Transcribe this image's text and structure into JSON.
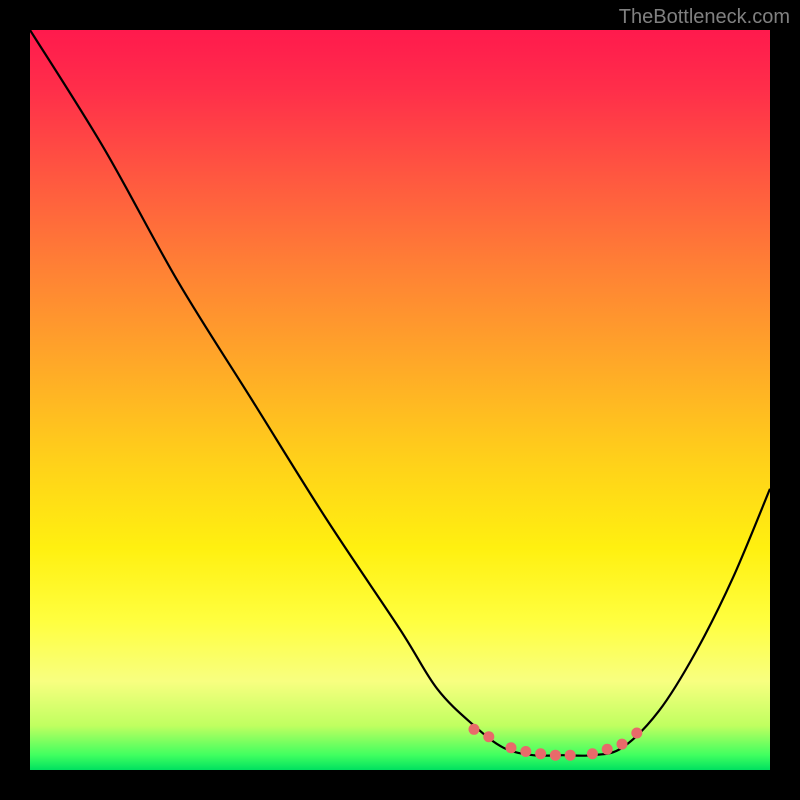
{
  "watermark": "TheBottleneck.com",
  "chart_data": {
    "type": "line",
    "title": "",
    "xlabel": "",
    "ylabel": "",
    "xlim": [
      0,
      100
    ],
    "ylim": [
      0,
      100
    ],
    "curve": [
      {
        "x": 0,
        "y": 100
      },
      {
        "x": 10,
        "y": 84
      },
      {
        "x": 20,
        "y": 66
      },
      {
        "x": 30,
        "y": 50
      },
      {
        "x": 40,
        "y": 34
      },
      {
        "x": 50,
        "y": 19
      },
      {
        "x": 55,
        "y": 11
      },
      {
        "x": 60,
        "y": 6
      },
      {
        "x": 64,
        "y": 3
      },
      {
        "x": 68,
        "y": 2
      },
      {
        "x": 72,
        "y": 2
      },
      {
        "x": 76,
        "y": 2
      },
      {
        "x": 80,
        "y": 3
      },
      {
        "x": 85,
        "y": 8
      },
      {
        "x": 90,
        "y": 16
      },
      {
        "x": 95,
        "y": 26
      },
      {
        "x": 100,
        "y": 38
      }
    ],
    "highlight_points": [
      {
        "x": 60,
        "y": 5.5
      },
      {
        "x": 62,
        "y": 4.5
      },
      {
        "x": 65,
        "y": 3
      },
      {
        "x": 67,
        "y": 2.5
      },
      {
        "x": 69,
        "y": 2.2
      },
      {
        "x": 71,
        "y": 2
      },
      {
        "x": 73,
        "y": 2
      },
      {
        "x": 76,
        "y": 2.2
      },
      {
        "x": 78,
        "y": 2.8
      },
      {
        "x": 80,
        "y": 3.5
      },
      {
        "x": 82,
        "y": 5
      }
    ],
    "colors": {
      "gradient_top": "#ff1a4d",
      "gradient_bottom": "#00e060",
      "curve": "#000000",
      "dots": "#e86a6a",
      "background": "#000000"
    }
  }
}
